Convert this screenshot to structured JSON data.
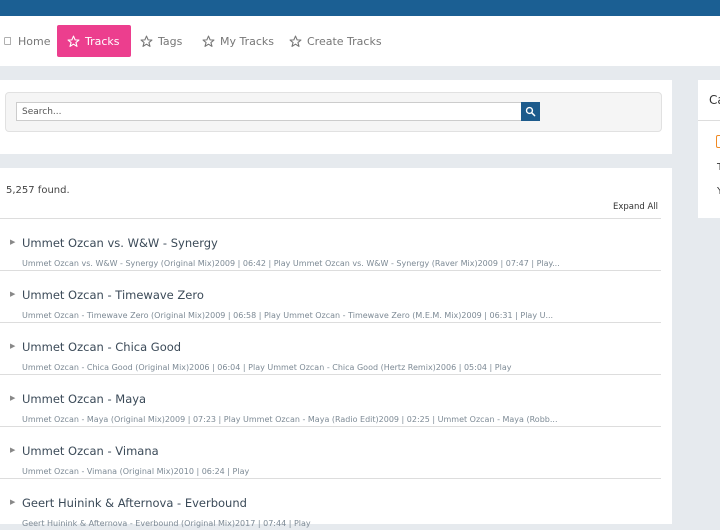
{
  "nav": {
    "items": [
      {
        "label": "Home",
        "icon": "home-icon"
      },
      {
        "label": "Tracks",
        "icon": "star-icon",
        "active": true
      },
      {
        "label": "Tags",
        "icon": "star-icon"
      },
      {
        "label": "My Tracks",
        "icon": "star-icon"
      },
      {
        "label": "Create Tracks",
        "icon": "star-icon"
      }
    ]
  },
  "search": {
    "placeholder": "Search...",
    "button_icon": "search-icon"
  },
  "results": {
    "found_text": "5,257 found.",
    "expand_label": "Expand All",
    "tracks": [
      {
        "title": "Ummet Ozcan vs. W&W - Synergy",
        "detail": "Ummet Ozcan vs. W&W - Synergy (Original Mix)2009 | 06:42 | Play Ummet Ozcan vs. W&W - Synergy (Raver Mix)2009 | 07:47 | Play..."
      },
      {
        "title": "Ummet Ozcan - Timewave Zero",
        "detail": "Ummet Ozcan - Timewave Zero (Original Mix)2009 | 06:58 | Play Ummet Ozcan - Timewave Zero (M.E.M. Mix)2009 | 06:31 | Play U..."
      },
      {
        "title": "Ummet Ozcan - Chica Good",
        "detail": "Ummet Ozcan - Chica Good (Original Mix)2006 | 06:04 | Play Ummet Ozcan - Chica Good (Hertz Remix)2006 | 05:04 | Play"
      },
      {
        "title": "Ummet Ozcan - Maya",
        "detail": "Ummet Ozcan - Maya (Original Mix)2009 | 07:23 | Play Ummet Ozcan - Maya (Radio Edit)2009 | 02:25 | Ummet Ozcan - Maya (Robb..."
      },
      {
        "title": "Ummet Ozcan - Vimana",
        "detail": "Ummet Ozcan - Vimana (Original Mix)2010 | 06:24 | Play"
      },
      {
        "title": "Geert Huinink & Afternova - Everbound",
        "detail": "Geert Huinink & Afternova - Everbound (Original Mix)2017 | 07:44 | Play"
      }
    ]
  },
  "sidebar": {
    "heading": "Ca",
    "item_1": "T",
    "item_2": "Y",
    "feed_icon": "rss-icon"
  },
  "colors": {
    "topbar": "#1b5f93",
    "accent": "#ec3e8e",
    "search_button": "#1d5b8c",
    "background": "#e6eaee"
  }
}
